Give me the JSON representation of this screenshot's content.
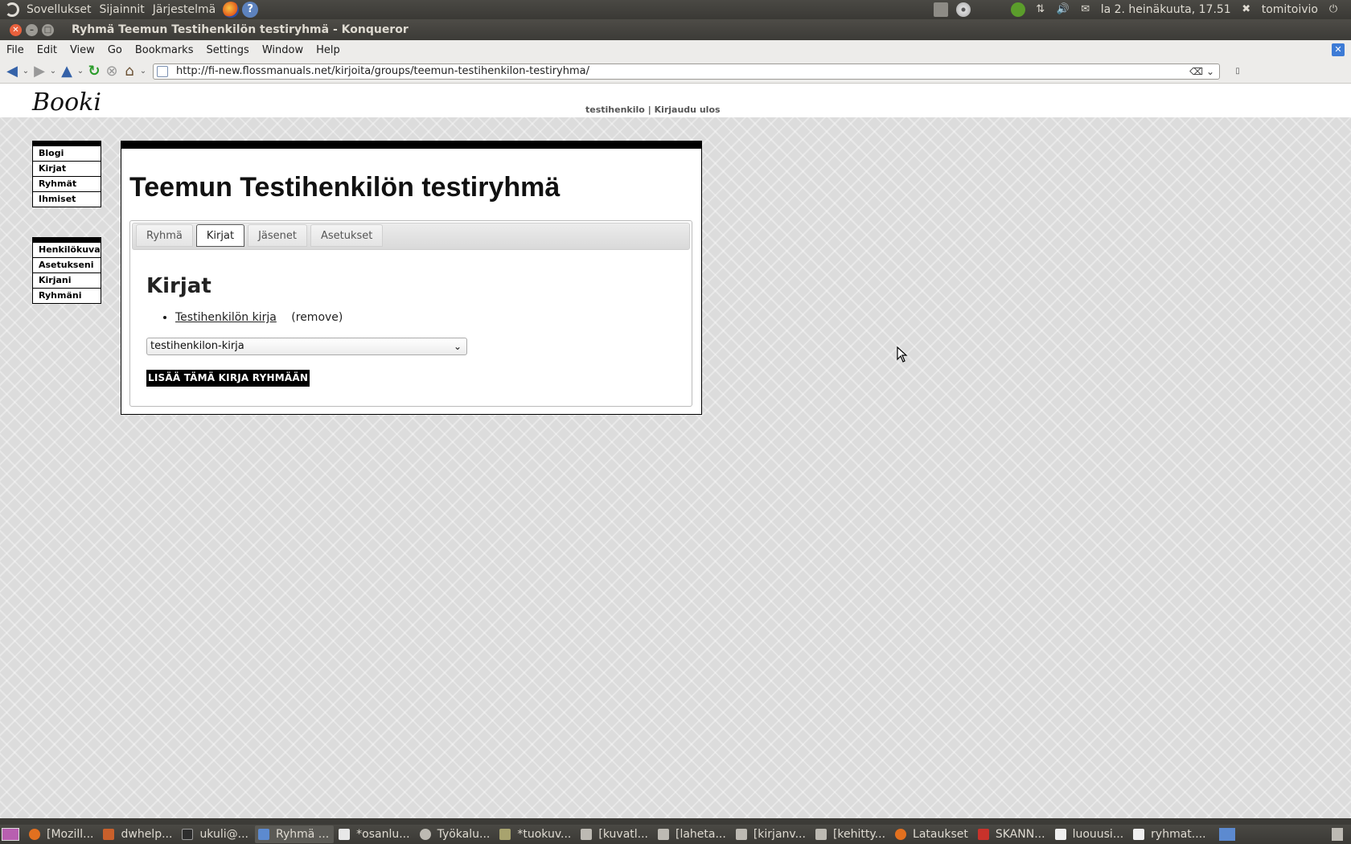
{
  "top_panel": {
    "menus": [
      "Sovellukset",
      "Sijainnit",
      "Järjestelmä"
    ],
    "clock": "la  2. heinäkuuta, 17.51",
    "user": "tomitoivio"
  },
  "window": {
    "title": "Ryhmä Teemun Testihenkilön testiryhmä - Konqueror"
  },
  "menubar": {
    "items": [
      "File",
      "Edit",
      "View",
      "Go",
      "Bookmarks",
      "Settings",
      "Window",
      "Help"
    ]
  },
  "toolbar": {
    "url": "http://fi-new.flossmanuals.net/kirjoita/groups/teemun-testihenkilon-testiryhma/"
  },
  "site": {
    "logo": "Booki",
    "user_link": "testihenkilo",
    "separator": "|",
    "logout_link": "Kirjaudu ulos",
    "nav_main": [
      "Blogi",
      "Kirjat",
      "Ryhmät",
      "Ihmiset"
    ],
    "nav_user": [
      "Henkilökuva",
      "Asetukseni",
      "Kirjani",
      "Ryhmäni"
    ]
  },
  "group_page": {
    "title": "Teemun Testihenkilön testiryhmä",
    "tabs": [
      "Ryhmä",
      "Kirjat",
      "Jäsenet",
      "Asetukset"
    ],
    "active_tab": "Kirjat",
    "section_title": "Kirjat",
    "books": [
      {
        "title": "Testihenkilön kirja",
        "action": "(remove)"
      }
    ],
    "select_value": "testihenkilon-kirja",
    "add_button": "LISÄÄ TÄMÄ KIRJA RYHMÄÄN"
  },
  "taskbar": {
    "items": [
      "[Mozill...",
      "dwhelp...",
      "ukuli@...",
      "Ryhmä ...",
      "*osanlu...",
      "Työkalu...",
      "*tuokuv...",
      "[kuvatl...",
      "[laheta...",
      "[kirjanv...",
      "[kehitty...",
      "Lataukset",
      "SKANN...",
      "luouusi...",
      "ryhmat...."
    ],
    "active_index": 3
  },
  "colors": {
    "panel_bg": "#3c3b37",
    "close_button": "#e9603c",
    "page_bg": "#dcdcdc",
    "nav_border": "#000000"
  },
  "icons": {
    "back": "arrow-left-icon",
    "forward": "arrow-right-icon",
    "up": "arrow-up-icon",
    "reload": "reload-icon",
    "stop": "stop-icon",
    "home": "home-icon"
  }
}
